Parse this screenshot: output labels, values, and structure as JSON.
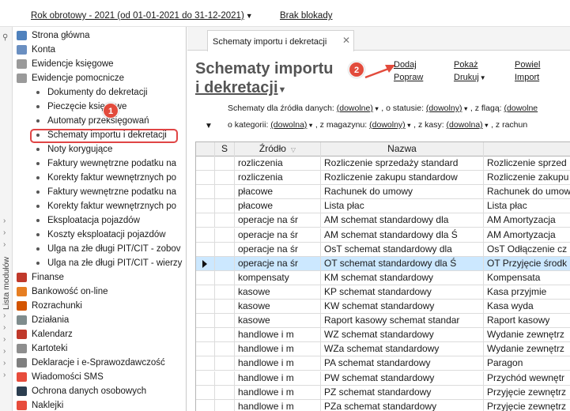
{
  "header": {
    "period_label": "Rok obrotowy - 2021  (od 01-01-2021 do 31-12-2021)",
    "block_label": "Brak blokady"
  },
  "strip": {
    "label": "Lista modułów"
  },
  "nav": [
    {
      "label": "Strona główna",
      "kind": "top",
      "icon": "home-icon",
      "color": "#4f81bd"
    },
    {
      "label": "Konta",
      "kind": "top",
      "icon": "accounts-icon",
      "color": "#6a8fc1"
    },
    {
      "label": "Ewidencje księgowe",
      "kind": "top",
      "icon": "ledger-icon",
      "color": "#9a9a9a"
    },
    {
      "label": "Ewidencje pomocnicze",
      "kind": "top",
      "icon": "ledger-aux-icon",
      "color": "#9a9a9a"
    },
    {
      "label": "Dokumenty do dekretacji",
      "kind": "sub"
    },
    {
      "label": "Pieczęcie księgowe",
      "kind": "sub"
    },
    {
      "label": "Automaty przeksięgowań",
      "kind": "sub"
    },
    {
      "label": "Schematy importu i dekretacji",
      "kind": "sub"
    },
    {
      "label": "Noty korygujące",
      "kind": "sub"
    },
    {
      "label": "Faktury wewnętrzne podatku na",
      "kind": "sub"
    },
    {
      "label": "Korekty faktur wewnętrznych po",
      "kind": "sub"
    },
    {
      "label": "Faktury wewnętrzne podatku na",
      "kind": "sub"
    },
    {
      "label": "Korekty faktur wewnętrznych po",
      "kind": "sub"
    },
    {
      "label": "Eksploatacja pojazdów",
      "kind": "sub"
    },
    {
      "label": "Koszty eksploatacji pojazdów",
      "kind": "sub"
    },
    {
      "label": "Ulga na złe długi PIT/CIT - zobov",
      "kind": "sub"
    },
    {
      "label": "Ulga na złe długi PIT/CIT - wierzy",
      "kind": "sub"
    },
    {
      "label": "Finanse",
      "kind": "top",
      "icon": "finance-icon",
      "color": "#c0392b"
    },
    {
      "label": "Bankowość on-line",
      "kind": "top",
      "icon": "bank-icon",
      "color": "#e67e22"
    },
    {
      "label": "Rozrachunki",
      "kind": "top",
      "icon": "settlements-icon",
      "color": "#d35400"
    },
    {
      "label": "Działania",
      "kind": "top",
      "icon": "actions-icon",
      "color": "#7f8c8d"
    },
    {
      "label": "Kalendarz",
      "kind": "top",
      "icon": "calendar-icon",
      "color": "#c0392b"
    },
    {
      "label": "Kartoteki",
      "kind": "top",
      "icon": "cards-icon",
      "color": "#8e8e8e"
    },
    {
      "label": "Deklaracje i e-Sprawozdawczość",
      "kind": "top",
      "icon": "declarations-icon",
      "color": "#7f7f7f"
    },
    {
      "label": "Wiadomości SMS",
      "kind": "top",
      "icon": "sms-icon",
      "color": "#e74c3c"
    },
    {
      "label": "Ochrona danych osobowych",
      "kind": "top",
      "icon": "privacy-icon",
      "color": "#2c3e50"
    },
    {
      "label": "Naklejki",
      "kind": "top",
      "icon": "stickers-icon",
      "color": "#e74c3c"
    }
  ],
  "tab": {
    "label": "Schematy importu i dekretacji",
    "close": "✕"
  },
  "page": {
    "title_line1": "Schematy importu",
    "title_line2": "i dekretacji",
    "actions": {
      "add": "Dodaj",
      "show": "Pokaż",
      "link": "Powiel",
      "import_data": "Popraw",
      "print": "Drukuj",
      "import": "Import"
    }
  },
  "filters": {
    "row1": {
      "t1": "Schematy dla źródła danych:",
      "v1": "(dowolne)",
      "t2": ", o statusie:",
      "v2": "(dowolny)",
      "t3": ", z flagą:",
      "v3": "(dowolne"
    },
    "row2": {
      "t1": "o kategorii:",
      "v1": "(dowolna)",
      "t2": ", z magazynu:",
      "v2": "(dowolny)",
      "t3": ", z kasy:",
      "v3": "(dowolna)",
      "t4": ", z rachun"
    }
  },
  "grid": {
    "columns": [
      "",
      "S",
      "Źródło",
      "Nazwa",
      ""
    ],
    "rows": [
      {
        "src": "rozliczenia",
        "name": "Rozliczenie sprzedaży standard",
        "desc": "Rozliczenie sprzed"
      },
      {
        "src": "rozliczenia",
        "name": "Rozliczenie zakupu standardow",
        "desc": "Rozliczenie zakupu"
      },
      {
        "src": "płacowe",
        "name": "Rachunek do umowy",
        "desc": "Rachunek do umow"
      },
      {
        "src": "płacowe",
        "name": "Lista płac",
        "desc": "Lista płac"
      },
      {
        "src": "operacje na śr",
        "name": "AM schemat standardowy dla",
        "desc": "AM Amortyzacja"
      },
      {
        "src": "operacje na śr",
        "name": "AM schemat standardowy dla Ś",
        "desc": "AM Amortyzacja"
      },
      {
        "src": "operacje na śr",
        "name": "OsT schemat standardowy dla",
        "desc": "OsT Odłączenie cz"
      },
      {
        "src": "operacje na śr",
        "name": "OT schemat standardowy dla Ś",
        "desc": "OT Przyjęcie środk",
        "selected": true
      },
      {
        "src": "kompensaty",
        "name": "KM schemat standardowy",
        "desc": "Kompensata"
      },
      {
        "src": "kasowe",
        "name": "KP schemat standardowy",
        "desc": "Kasa przyjmie"
      },
      {
        "src": "kasowe",
        "name": "KW schemat standardowy",
        "desc": "Kasa wyda"
      },
      {
        "src": "kasowe",
        "name": "Raport kasowy schemat standar",
        "desc": "Raport kasowy"
      },
      {
        "src": "handlowe i m",
        "name": "WZ schemat standardowy",
        "desc": "Wydanie zewnętrz"
      },
      {
        "src": "handlowe i m",
        "name": "WZa schemat standardowy",
        "desc": "Wydanie zewnętrz"
      },
      {
        "src": "handlowe i m",
        "name": "PA schemat standardowy",
        "desc": "Paragon"
      },
      {
        "src": "handlowe i m",
        "name": "PW schemat standardowy",
        "desc": "Przychód wewnętr"
      },
      {
        "src": "handlowe i m",
        "name": "PZ schemat standardowy",
        "desc": "Przyjęcie zewnętrz"
      },
      {
        "src": "handlowe i m",
        "name": "PZa schemat standardowy",
        "desc": "Przyjęcie zewnętrz"
      }
    ]
  },
  "annotations": {
    "step1": "1",
    "step2": "2",
    "color": "#e24b3c"
  }
}
